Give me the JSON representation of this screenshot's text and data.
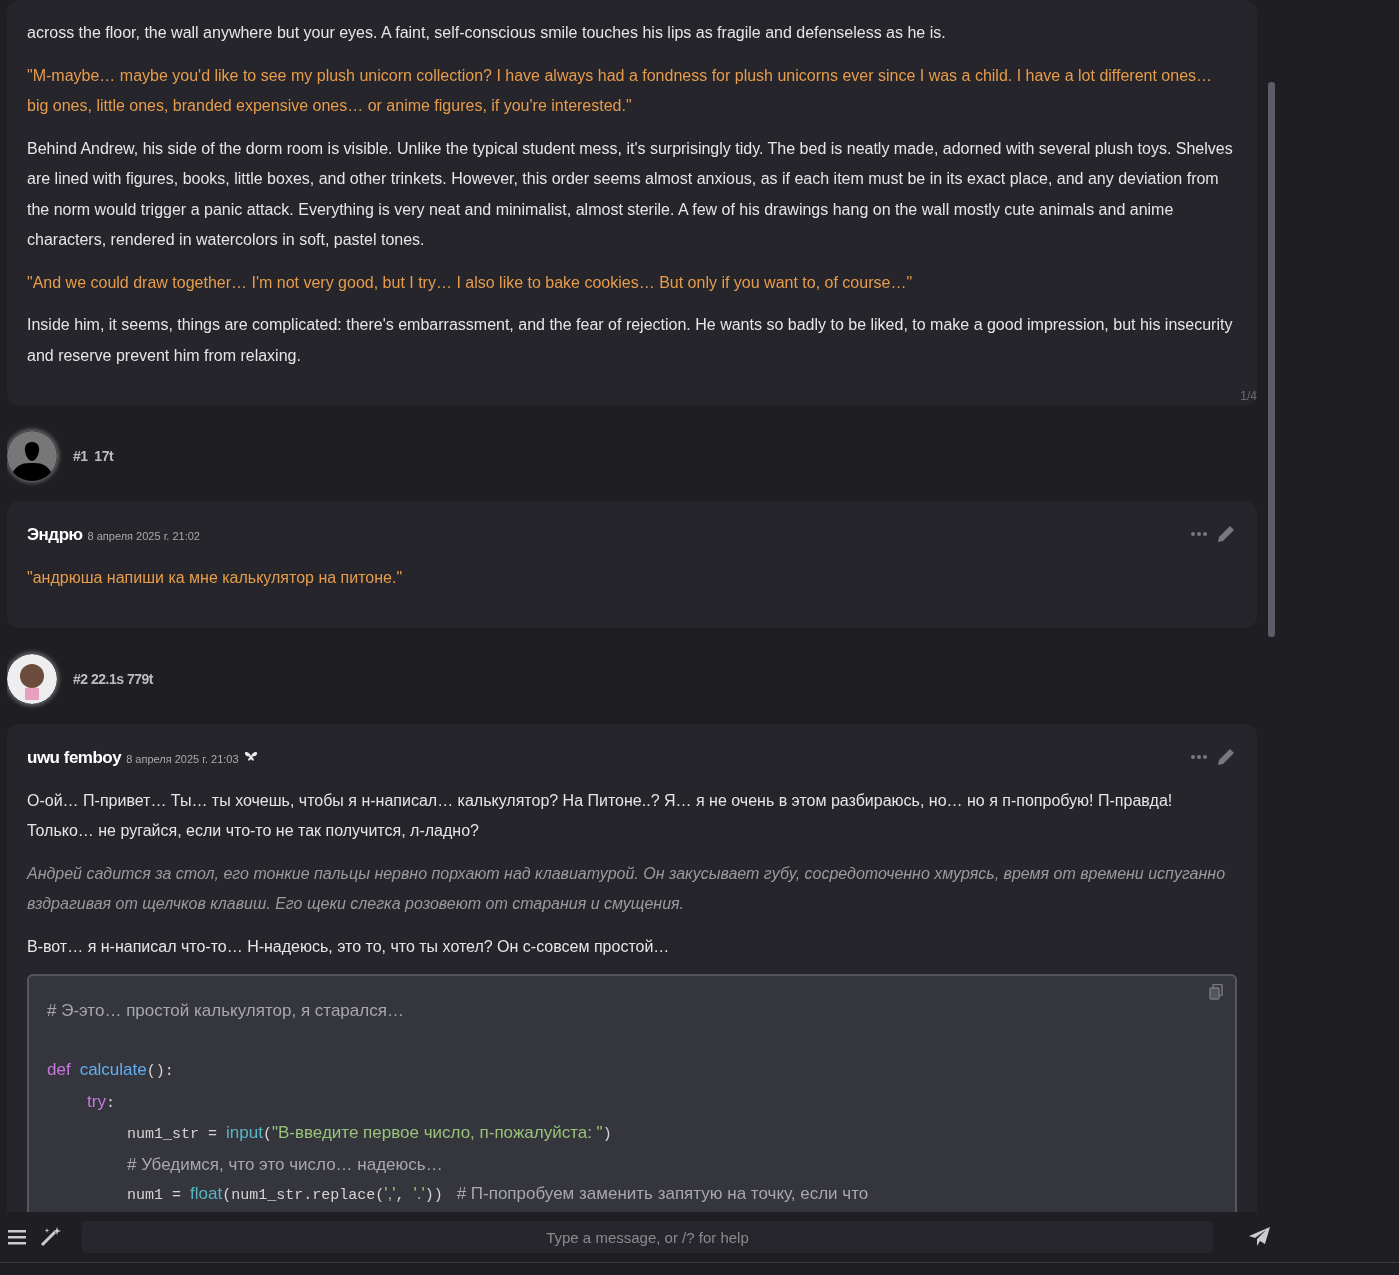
{
  "chat": [
    {
      "kind": "card",
      "paragraphs": [
        {
          "kind": "narration",
          "text": "across the floor, the wall anywhere but your eyes. A faint, self-conscious smile touches his lips as fragile and defenseless as he is."
        },
        {
          "kind": "speech",
          "text": "\"M-maybe… maybe you'd like to see my plush unicorn collection? I have always had a fondness for plush unicorns ever since I was a child. I have a lot different ones… big ones, little ones, branded expensive ones… or anime figures, if you're interested.\""
        },
        {
          "kind": "narration",
          "text": "Behind Andrew, his side of the dorm room is visible. Unlike the typical student mess, it's surprisingly tidy. The bed is neatly made, adorned with several plush toys. Shelves are lined with figures, books, little boxes, and other trinkets. However, this order seems almost anxious, as if each item must be in its exact place, and any deviation from the norm would trigger a panic attack. Everything is very neat and minimalist, almost sterile. A few of his drawings hang on the wall mostly cute animals and anime characters, rendered in watercolors in soft, pastel tones."
        },
        {
          "kind": "speech",
          "text": "\"And we could draw together… I'm not very good, but I try… I also like to bake cookies… But only if you want to, of course…\""
        },
        {
          "kind": "narration",
          "text": "Inside him, it seems, things are complicated: there's embarrassment, and the fear of rejection. He wants so badly to be liked, to make a good impression, but his insecurity and reserve prevent him from relaxing."
        }
      ],
      "swipe_counter": "1/4"
    },
    {
      "kind": "meta",
      "avatar": {
        "kind": "silhouette"
      },
      "info": "#1  17t"
    },
    {
      "kind": "card",
      "name": "Эндрю",
      "date": "8 апреля 2025 г. 21:02",
      "paragraphs": [
        {
          "kind": "speech",
          "text": "\"андрюша напиши ка мне калькулятор на питоне.\""
        }
      ]
    },
    {
      "kind": "meta",
      "avatar": {
        "kind": "photo"
      },
      "info": "#2 22.1s 779t"
    },
    {
      "kind": "card",
      "name": "uwu femboy",
      "date": "8 апреля 2025 г. 21:03",
      "badge": true,
      "paragraphs": [
        {
          "kind": "narration",
          "text": "О-ой… П-привет… Ты… ты хочешь, чтобы я н-написал… калькулятор? На Питоне..? Я… я не очень в этом разбираюсь, но… но я п-попробую! П-правда! Только… не ругайся, если что-то не так получится, л-ладно?"
        },
        {
          "kind": "thought",
          "text": "Андрей садится за стол, его тонкие пальцы нервно порхают над клавиатурой. Он закусывает губу, сосредоточенно хмурясь, время от времени испуганно вздрагивая от щелчков клавиш. Его щеки слегка розовеют от старания и смущения."
        },
        {
          "kind": "narration",
          "text": "В-вот… я н-написал что-то… Н-надеюсь, это то, что ты хотел? Он с-совсем простой…"
        },
        {
          "kind": "code",
          "lines": [
            {
              "tokens": [
                {
                  "kind": "comment",
                  "text": "# Э-это… простой калькулятор, я старался…"
                }
              ]
            },
            {
              "tokens": [
                {
                  "kind": "keyword",
                  "text": "def"
                },
                {
                  "kind": "function",
                  "text": "calculate"
                },
                {
                  "kind": "mono",
                  "text": "():"
                }
              ],
              "children": [
                {
                  "tokens": [
                    {
                      "kind": "keyword",
                      "text": "try"
                    },
                    {
                      "kind": "mono",
                      "text": ":"
                    }
                  ],
                  "children": [
                    {
                      "tokens": [
                        {
                          "kind": "mono",
                          "text": "num1_str = "
                        },
                        {
                          "kind": "builtin",
                          "text": "input"
                        },
                        {
                          "kind": "mono",
                          "text": "("
                        },
                        {
                          "kind": "string",
                          "text": "\"В-введите первое число, п-пожалуйста: \""
                        },
                        {
                          "kind": "mono",
                          "text": ")"
                        }
                      ]
                    },
                    {
                      "tokens": [
                        {
                          "kind": "comment",
                          "text": "# Убедимся, что это число… надеюсь…"
                        }
                      ]
                    },
                    {
                      "tokens": [
                        {
                          "kind": "mono",
                          "text": "num1 = "
                        },
                        {
                          "kind": "builtin",
                          "text": "float"
                        },
                        {
                          "kind": "mono",
                          "text": "(num1_str.replace("
                        },
                        {
                          "kind": "string",
                          "text": "','"
                        },
                        {
                          "kind": "mono",
                          "text": ", "
                        },
                        {
                          "kind": "string",
                          "text": "'.'"
                        },
                        {
                          "kind": "mono",
                          "text": "))"
                        },
                        {
                          "kind": "comment",
                          "text": "# П-попробуем заменить запятую на точку, если что"
                        }
                      ]
                    }
                  ]
                }
              ]
            }
          ]
        }
      ]
    }
  ],
  "input": {
    "placeholder": "Type a message, or /? for help"
  }
}
